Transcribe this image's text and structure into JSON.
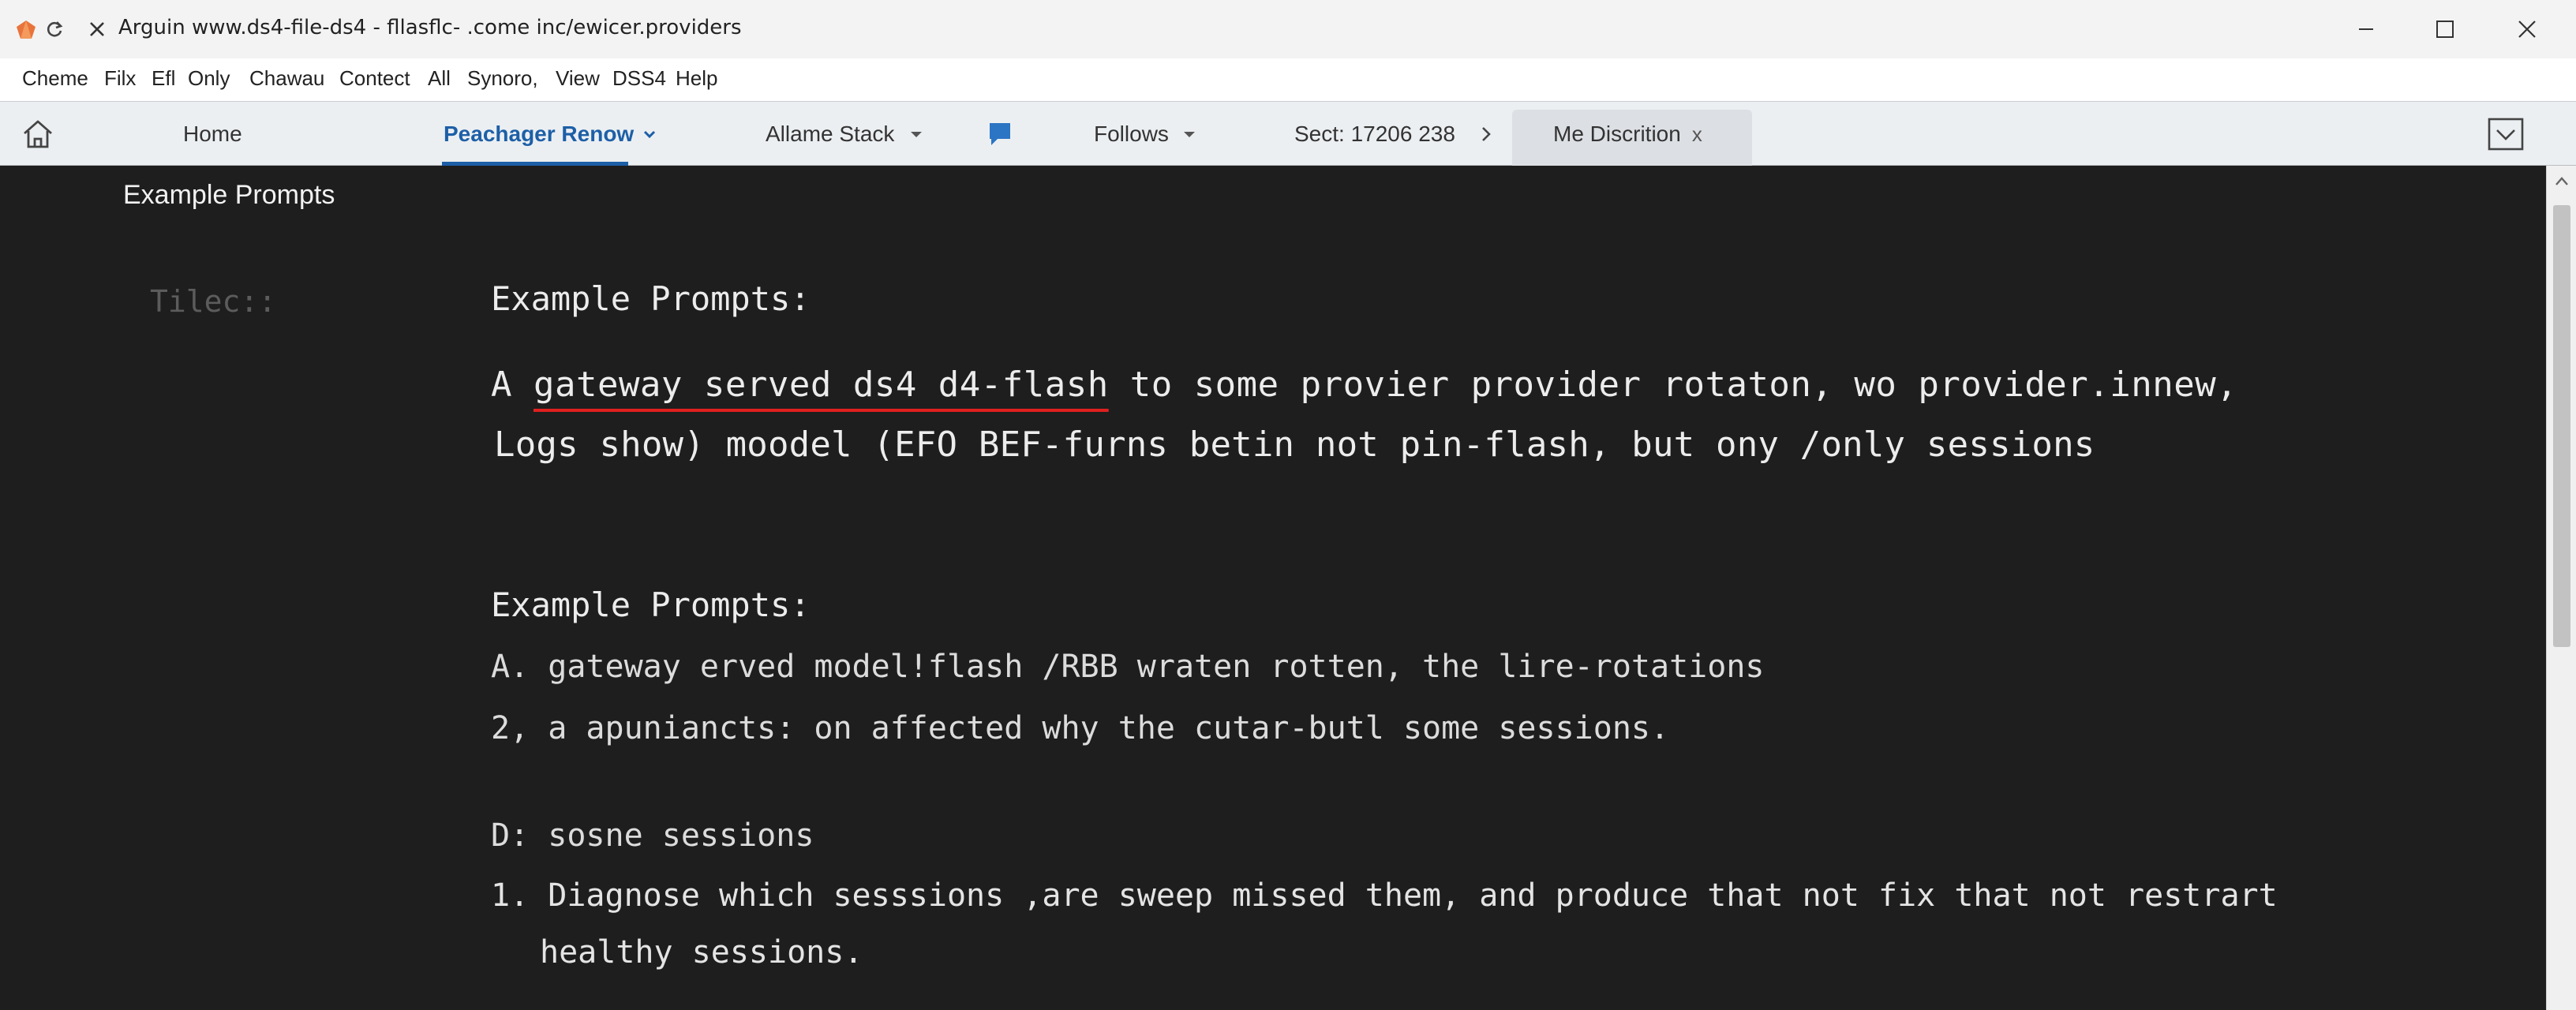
{
  "window": {
    "title": "Arguin www.ds4-file-ds4 - fllasflc- .come inc/ewicer.providers"
  },
  "menu": [
    "Cheme",
    "Filx",
    "Efl",
    "Only",
    "Chawau",
    "Contect",
    "All",
    "Synoro,",
    "View",
    "DSS4",
    "Help"
  ],
  "nav": {
    "home": "Home",
    "active": "Peachager Renow",
    "allame": "Allame Stack",
    "follows": "Follows",
    "sect": "Sect: 17206 238",
    "tab": "Me Discrition",
    "tab_close": "x"
  },
  "content": {
    "page_heading": "Example Prompts",
    "side_label": "Tilec::",
    "section1": {
      "heading": "Example Prompts:",
      "line1_a": "A ",
      "line1_b": "gateway served ds4 d4-flash",
      "line1_c": " to some  provier provider rotaton, wo provider.innew,",
      "line2": "Logs show) moodel (EFO BEF-furns betin not pin-flash, but ony /only sessions"
    },
    "section2": {
      "heading": "Example Prompts:",
      "line1": "A. gateway erved model!flash /RBB wraten rotten, the lire-rotations",
      "line2": "2, a apuniancts: on  affected why the cutar-butl some sessions."
    },
    "section3": {
      "line1": "D: sosne sessions",
      "line2": "1. Diagnose which sesssions ,are sweep missed them, and produce that not fix that not restrart",
      "line3": "healthy sessions."
    }
  },
  "colors": {
    "accent": "#1d5fa7",
    "spell_underline": "#e02020",
    "background": "#1e1e1e"
  }
}
